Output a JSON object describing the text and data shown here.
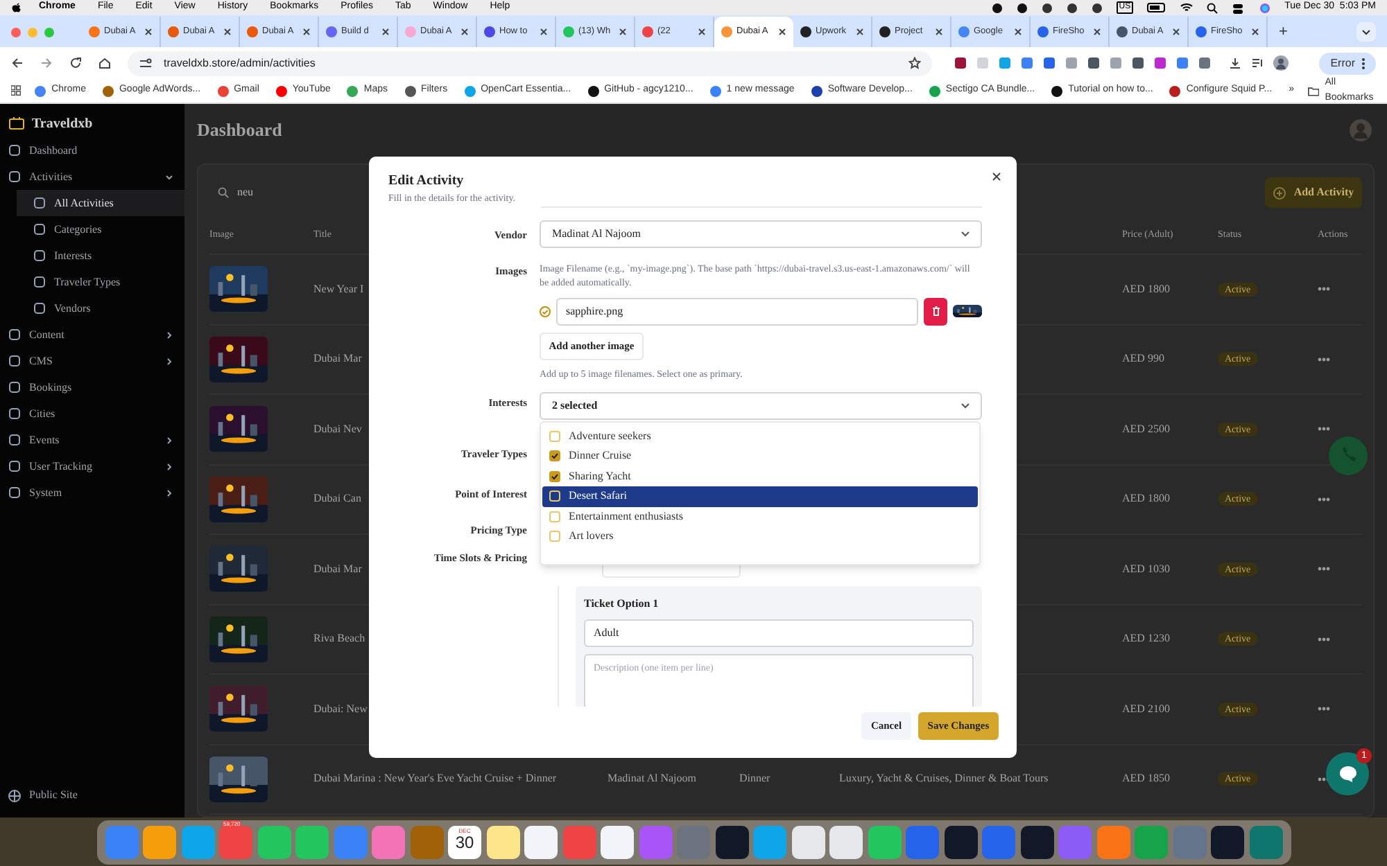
{
  "menubar": {
    "app": "Chrome",
    "menus": [
      "File",
      "Edit",
      "View",
      "History",
      "Bookmarks",
      "Profiles",
      "Tab",
      "Window",
      "Help"
    ],
    "input_source": "US",
    "clock": "Tue Dec 30  5:03 PM"
  },
  "tabs": [
    {
      "title": "Dubai A",
      "selected": false,
      "color": "#f97316"
    },
    {
      "title": "Dubai A",
      "selected": false,
      "color": "#ea580c"
    },
    {
      "title": "Dubai A",
      "selected": false,
      "color": "#ea580c"
    },
    {
      "title": "Build d",
      "selected": false,
      "color": "#6366f1"
    },
    {
      "title": "Dubai A",
      "selected": false,
      "color": "#f9a8d4"
    },
    {
      "title": "How to",
      "selected": false,
      "color": "#4f46e5"
    },
    {
      "title": "(13) Wh",
      "selected": false,
      "color": "#22c55e"
    },
    {
      "title": "(22",
      "selected": false,
      "color": "#ef4444"
    },
    {
      "title": "Dubai A",
      "selected": true,
      "color": "#fb923c"
    },
    {
      "title": "Upwork",
      "selected": false,
      "color": "#222222"
    },
    {
      "title": "Project",
      "selected": false,
      "color": "#222222"
    },
    {
      "title": "Google",
      "selected": false,
      "color": "#4285f4"
    },
    {
      "title": "FireSho",
      "selected": false,
      "color": "#2563eb"
    },
    {
      "title": "Dubai A",
      "selected": false,
      "color": "#475569"
    },
    {
      "title": "FireSho",
      "selected": false,
      "color": "#2563eb"
    }
  ],
  "new_tab": "+",
  "address": "traveldxb.store/admin/activities",
  "profile_status": "Error",
  "bookmarks": [
    "Chrome",
    "Google AdWords...",
    "Gmail",
    "YouTube",
    "Maps",
    "Filters",
    "OpenCart Essentia...",
    "GitHub - agcy1210...",
    "1 new message",
    "Software Develop...",
    "Sectigo CA Bundle...",
    "Tutorial on how to...",
    "Configure Squid P..."
  ],
  "bookmarks_more": "»",
  "all_bookmarks": "All Bookmarks",
  "app": {
    "brand": "Traveldxb",
    "sidebar": [
      {
        "label": "Dashboard",
        "selected": false
      },
      {
        "label": "Activities",
        "selected": false,
        "expanded": true,
        "children": [
          {
            "label": "All Activities",
            "selected": true
          },
          {
            "label": "Categories",
            "selected": false
          },
          {
            "label": "Interests",
            "selected": false
          },
          {
            "label": "Traveler Types",
            "selected": false
          },
          {
            "label": "Vendors",
            "selected": false
          }
        ]
      },
      {
        "label": "Content",
        "selected": false,
        "expanded": false
      },
      {
        "label": "CMS",
        "selected": false,
        "expanded": false
      },
      {
        "label": "Bookings",
        "selected": false
      },
      {
        "label": "Cities",
        "selected": false
      },
      {
        "label": "Events",
        "selected": false,
        "expanded": false
      },
      {
        "label": "User Tracking",
        "selected": false,
        "expanded": false
      },
      {
        "label": "System",
        "selected": false,
        "expanded": false
      }
    ],
    "public_site": "Public Site",
    "heading": "Dashboard",
    "search": {
      "value": "neu"
    },
    "add_button": "Add Activity",
    "columns": [
      "Image",
      "Title",
      "Price (Adult)",
      "Status",
      "Actions"
    ],
    "rows": [
      {
        "title": "New Year I",
        "price": "AED 1800",
        "status": "Active"
      },
      {
        "title": "Dubai Mar",
        "price": "AED 990",
        "status": "Active"
      },
      {
        "title": "Dubai Nev",
        "price": "AED 2500",
        "status": "Active"
      },
      {
        "title": "Dubai Can",
        "price": "AED 1800",
        "status": "Active"
      },
      {
        "title": "Dubai Mar",
        "price": "AED 1030",
        "status": "Active"
      },
      {
        "title": "Riva Beach",
        "price": "AED 1230",
        "status": "Active"
      },
      {
        "title": "Dubai: New",
        "price": "AED 2100",
        "status": "Active"
      },
      {
        "title": "Dubai Marina : New Year's Eve Yacht Cruise + Dinner",
        "vendor": "Madinat Al Najoom",
        "category": "Dinner",
        "tags": "Luxury, Yacht & Cruises, Dinner & Boat Tours",
        "price": "AED 1850",
        "status": "Active"
      }
    ]
  },
  "modal": {
    "title": "Edit Activity",
    "subtitle": "Fill in the details for the activity.",
    "vendor": {
      "label": "Vendor",
      "value": "Madinat Al Najoom"
    },
    "images": {
      "label": "Images",
      "hint": "Image Filename (e.g., `my-image.png`). The base path `https://dubai-travel.s3.us-east-1.amazonaws.com/` will be added automatically.",
      "items": [
        {
          "filename": "sapphire.png",
          "primary": true
        }
      ],
      "add_button": "Add another image",
      "note": "Add up to 5 image filenames. Select one as primary."
    },
    "interests": {
      "label": "Interests",
      "value": "2 selected",
      "expanded": true,
      "options": [
        {
          "label": "Adventure seekers",
          "checked": false,
          "highlighted": false
        },
        {
          "label": "Dinner Cruise",
          "checked": true,
          "highlighted": false
        },
        {
          "label": "Sharing Yacht",
          "checked": true,
          "highlighted": false
        },
        {
          "label": "Desert Safari",
          "checked": false,
          "highlighted": true
        },
        {
          "label": "Entertainment enthusiasts",
          "checked": false,
          "highlighted": false
        },
        {
          "label": "Art lovers",
          "checked": false,
          "highlighted": false
        }
      ]
    },
    "covered_labels": [
      "Traveler Types",
      "Point of Interest",
      "Pricing Type",
      "Time Slots & Pricing"
    ],
    "ticket": {
      "title": "Ticket Option 1",
      "name": "Adult",
      "description_placeholder": "Description (one item per line)"
    },
    "cancel": "Cancel",
    "save": "Save Changes"
  },
  "chat_badge": "1",
  "dock": [
    {
      "color": "#3b82f6"
    },
    {
      "color": "#f59e0b"
    },
    {
      "color": "#0ea5e9"
    },
    {
      "color": "#ef4444",
      "badge": "59,720"
    },
    {
      "color": "#22c55e"
    },
    {
      "color": "#22c55e"
    },
    {
      "color": "#3b82f6"
    },
    {
      "color": "#f472b6"
    },
    {
      "color": "#a16207"
    },
    {
      "kind": "calendar",
      "month": "DEC",
      "day": "30"
    },
    {
      "color": "#fde68a"
    },
    {
      "color": "#f1f5f9"
    },
    {
      "color": "#ef4444"
    },
    {
      "color": "#f1f5f9"
    },
    {
      "color": "#a855f7"
    },
    {
      "color": "#6b7280"
    },
    {
      "color": "#111827"
    },
    {
      "color": "#0ea5e9"
    },
    {
      "color": "#e5e7eb"
    },
    {
      "color": "#e5e7eb"
    },
    {
      "color": "#22c55e"
    },
    {
      "color": "#2563eb"
    },
    {
      "color": "#111827"
    },
    {
      "color": "#2563eb"
    },
    {
      "color": "#111827"
    },
    {
      "color": "#8b5cf6"
    },
    {
      "color": "#f97316"
    },
    {
      "color": "#16a34a"
    },
    {
      "color": "#64748b"
    },
    {
      "color": "#111827"
    },
    {
      "color": "#0f766e"
    }
  ]
}
